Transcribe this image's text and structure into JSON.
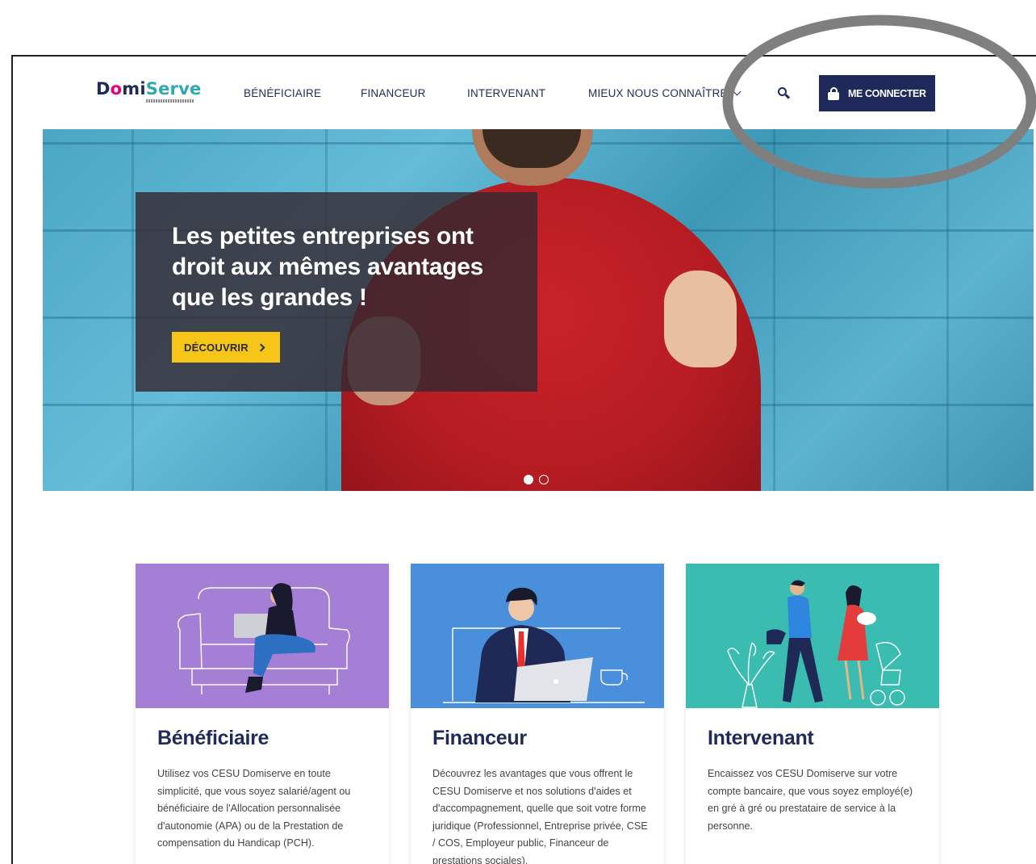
{
  "brand": {
    "name_part1": "D",
    "name_o": "o",
    "name_part2": "mi",
    "name_part3": "Serve"
  },
  "nav": {
    "items": [
      {
        "label": "BÉNÉFICIAIRE"
      },
      {
        "label": "FINANCEUR"
      },
      {
        "label": "INTERVENANT"
      },
      {
        "label": "MIEUX NOUS CONNAÎTRE"
      }
    ],
    "login_label": "ME CONNECTER"
  },
  "hero": {
    "title": "Les petites entreprises ont droit aux mêmes avantages que les grandes !",
    "cta_label": "DÉCOUVRIR",
    "slides_total": 2,
    "active_slide": 1
  },
  "cards": [
    {
      "title": "Bénéficiaire",
      "text": "Utilisez vos CESU Domiserve en toute simplicité, que vous soyez salarié/agent ou bénéficiaire de l'Allocation personnalisée d'autonomie (APA) ou de la Prestation de compensation du Handicap (PCH).",
      "color": "#a57fd6"
    },
    {
      "title": "Financeur",
      "text": "Découvrez les avantages que vous offrent le CESU Domiserve et nos solutions d'aides et d'accompagnement, quelle que soit votre forme juridique (Professionnel, Entreprise privée, CSE / COS, Employeur public, Financeur de prestations sociales).",
      "color": "#4a8fdc"
    },
    {
      "title": "Intervenant",
      "text": "Encaissez vos CESU Domiserve sur votre compte bancaire, que vous soyez employé(e) en gré à gré ou prestataire de service à la personne.",
      "color": "#3bbcb0"
    }
  ],
  "colors": {
    "navy": "#1f2a5b",
    "cta_yellow": "#f5c518",
    "highlight_ring": "#7f7f7f"
  }
}
